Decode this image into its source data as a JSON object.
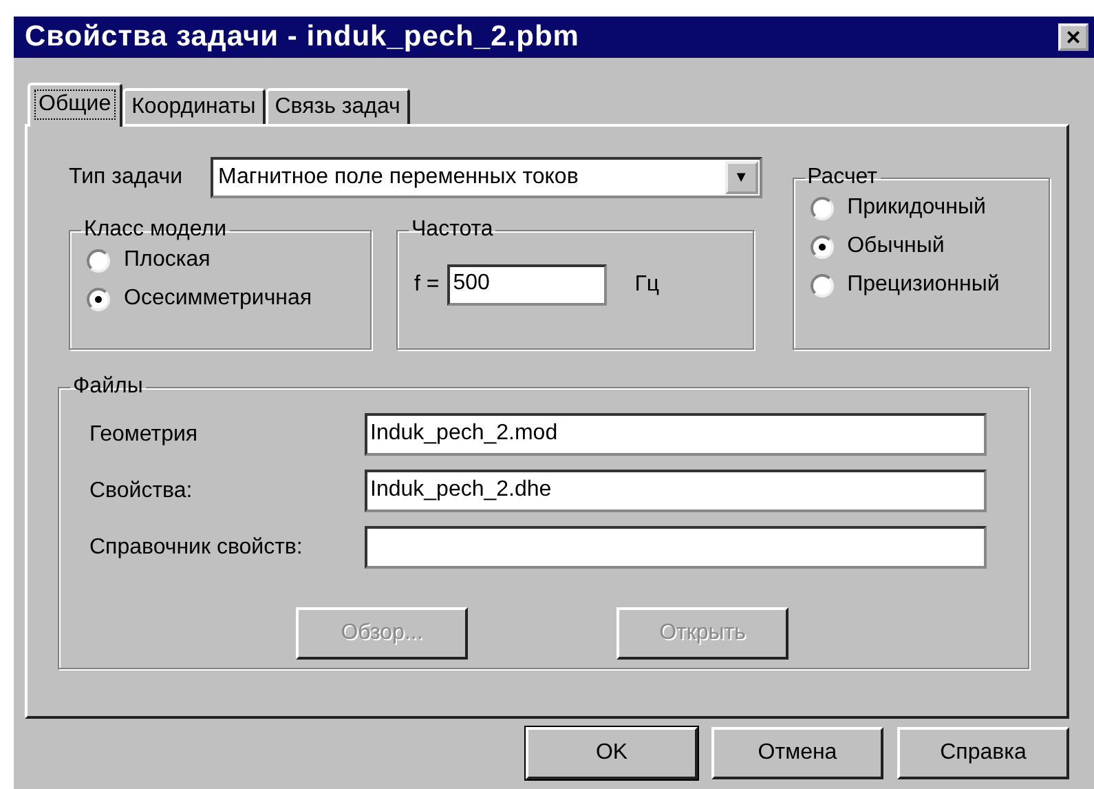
{
  "window": {
    "title": "Свойства задачи - induk_pech_2.pbm",
    "close": "×"
  },
  "tabs": [
    {
      "label": "Общие",
      "selected": true
    },
    {
      "label": "Координаты",
      "selected": false
    },
    {
      "label": "Связь задач",
      "selected": false
    }
  ],
  "task_type": {
    "label": "Тип задачи",
    "value": "Магнитное поле переменных токов",
    "arrow": "▼"
  },
  "model_class": {
    "title": "Класс модели",
    "options": [
      {
        "label": "Плоская",
        "selected": false
      },
      {
        "label": "Осесимметричная",
        "selected": true
      }
    ]
  },
  "frequency": {
    "title": "Частота",
    "label": "f =",
    "value": "500",
    "unit": "Гц"
  },
  "calculation": {
    "title": "Расчет",
    "options": [
      {
        "label": "Прикидочный",
        "selected": false
      },
      {
        "label": "Обычный",
        "selected": true
      },
      {
        "label": "Прецизионный",
        "selected": false
      }
    ]
  },
  "files": {
    "title": "Файлы",
    "fields": [
      {
        "label": "Геометрия",
        "value": "Induk_pech_2.mod"
      },
      {
        "label": "Свойства:",
        "value": "Induk_pech_2.dhe"
      },
      {
        "label": "Справочник свойств:"
      }
    ],
    "buttons": [
      {
        "label": "Обзор...",
        "disabled": true
      },
      {
        "label": "Открыть",
        "disabled": true
      }
    ]
  },
  "buttons": [
    {
      "label": "OK",
      "default": true
    },
    {
      "label": "Отмена",
      "default": false
    },
    {
      "label": "Справка",
      "default": false
    }
  ]
}
